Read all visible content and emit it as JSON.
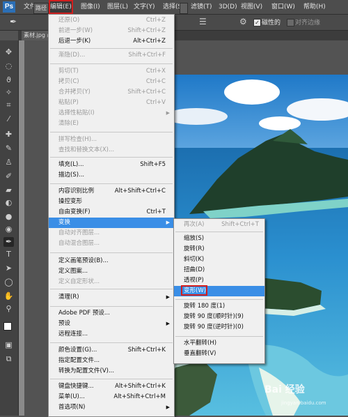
{
  "app": {
    "logo": "Ps"
  },
  "menubar": {
    "file": "文件(F)",
    "edit": "编辑(E)",
    "image": "图像(I)",
    "layer": "图层(L)",
    "type": "文字(Y)",
    "select": "选择(S)",
    "filter": "滤镜(T)",
    "threed": "3D(D)",
    "view": "视图(V)",
    "window": "窗口(W)",
    "help": "帮助(H)"
  },
  "options": {
    "preset": "路径",
    "snap_label": "磁性的",
    "align_edges": "对齐边缘"
  },
  "document": {
    "tab": "素材.jpg @"
  },
  "edit_menu": [
    {
      "label": "还原(O)",
      "shortcut": "Ctrl+Z",
      "disabled": true
    },
    {
      "label": "前进一步(W)",
      "shortcut": "Shift+Ctrl+Z",
      "disabled": true
    },
    {
      "label": "后退一步(K)",
      "shortcut": "Alt+Ctrl+Z",
      "disabled": false
    },
    {
      "label": "渐隐(D)...",
      "shortcut": "Shift+Ctrl+F",
      "disabled": true
    },
    {
      "label": "剪切(T)",
      "shortcut": "Ctrl+X",
      "disabled": true
    },
    {
      "label": "拷贝(C)",
      "shortcut": "Ctrl+C",
      "disabled": true
    },
    {
      "label": "合并拷贝(Y)",
      "shortcut": "Shift+Ctrl+C",
      "disabled": true
    },
    {
      "label": "粘贴(P)",
      "shortcut": "Ctrl+V",
      "disabled": true
    },
    {
      "label": "选择性粘贴(I)",
      "shortcut": "",
      "disabled": true,
      "submenu": true
    },
    {
      "label": "清除(E)",
      "shortcut": "",
      "disabled": true
    },
    {
      "label": "拼写检查(H)...",
      "shortcut": "",
      "disabled": true
    },
    {
      "label": "查找和替换文本(X)...",
      "shortcut": "",
      "disabled": true
    },
    {
      "label": "填充(L)...",
      "shortcut": "Shift+F5",
      "disabled": false
    },
    {
      "label": "描边(S)...",
      "shortcut": "",
      "disabled": false
    },
    {
      "label": "内容识别比例",
      "shortcut": "Alt+Shift+Ctrl+C",
      "disabled": false
    },
    {
      "label": "操控变形",
      "shortcut": "",
      "disabled": false
    },
    {
      "label": "自由变换(F)",
      "shortcut": "Ctrl+T",
      "disabled": false
    },
    {
      "label": "变换",
      "shortcut": "",
      "disabled": false,
      "submenu": true,
      "highlighted": true
    },
    {
      "label": "自动对齐图层...",
      "shortcut": "",
      "disabled": true
    },
    {
      "label": "自动混合图层...",
      "shortcut": "",
      "disabled": true
    },
    {
      "label": "定义画笔预设(B)...",
      "shortcut": "",
      "disabled": false
    },
    {
      "label": "定义图案...",
      "shortcut": "",
      "disabled": false
    },
    {
      "label": "定义自定形状...",
      "shortcut": "",
      "disabled": true
    },
    {
      "label": "清理(R)",
      "shortcut": "",
      "disabled": false,
      "submenu": true
    },
    {
      "label": "Adobe PDF 预设...",
      "shortcut": "",
      "disabled": false
    },
    {
      "label": "预设",
      "shortcut": "",
      "disabled": false,
      "submenu": true
    },
    {
      "label": "远程连接...",
      "shortcut": "",
      "disabled": false
    },
    {
      "label": "颜色设置(G)...",
      "shortcut": "Shift+Ctrl+K",
      "disabled": false
    },
    {
      "label": "指定配置文件...",
      "shortcut": "",
      "disabled": false
    },
    {
      "label": "转换为配置文件(V)...",
      "shortcut": "",
      "disabled": false
    },
    {
      "label": "键盘快捷键...",
      "shortcut": "Alt+Shift+Ctrl+K",
      "disabled": false
    },
    {
      "label": "菜单(U)...",
      "shortcut": "Alt+Shift+Ctrl+M",
      "disabled": false
    },
    {
      "label": "首选项(N)",
      "shortcut": "",
      "disabled": false,
      "submenu": true
    }
  ],
  "transform_menu": [
    {
      "label": "再次(A)",
      "shortcut": "Shift+Ctrl+T",
      "disabled": true
    },
    {
      "label": "缩放(S)",
      "shortcut": "",
      "disabled": false
    },
    {
      "label": "旋转(R)",
      "shortcut": "",
      "disabled": false
    },
    {
      "label": "斜切(K)",
      "shortcut": "",
      "disabled": false
    },
    {
      "label": "扭曲(D)",
      "shortcut": "",
      "disabled": false
    },
    {
      "label": "透视(P)",
      "shortcut": "",
      "disabled": false
    },
    {
      "label": "变形(W)",
      "shortcut": "",
      "disabled": false,
      "highlighted": true
    },
    {
      "label": "旋转 180 度(1)",
      "shortcut": "",
      "disabled": false
    },
    {
      "label": "旋转 90 度(顺时针)(9)",
      "shortcut": "",
      "disabled": false
    },
    {
      "label": "旋转 90 度(逆时针)(0)",
      "shortcut": "",
      "disabled": false
    },
    {
      "label": "水平翻转(H)",
      "shortcut": "",
      "disabled": false
    },
    {
      "label": "垂直翻转(V)",
      "shortcut": "",
      "disabled": false
    }
  ],
  "watermark": {
    "text": "Bai 经验",
    "url": "jingyan.baidu.com"
  }
}
